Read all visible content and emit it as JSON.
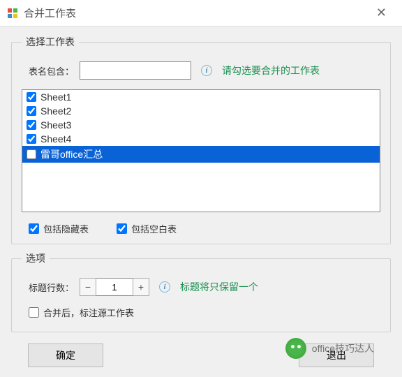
{
  "window": {
    "title": "合并工作表"
  },
  "group_select": {
    "legend": "选择工作表",
    "filter_label": "表名包含：",
    "filter_value": "",
    "hint": "请勾选要合并的工作表",
    "items": [
      {
        "label": "Sheet1",
        "checked": true,
        "selected": false
      },
      {
        "label": "Sheet2",
        "checked": true,
        "selected": false
      },
      {
        "label": "Sheet3",
        "checked": true,
        "selected": false
      },
      {
        "label": "Sheet4",
        "checked": true,
        "selected": false
      },
      {
        "label": "雷哥office汇总",
        "checked": false,
        "selected": true
      }
    ],
    "include_hidden": {
      "label": "包括隐藏表",
      "checked": true
    },
    "include_blank": {
      "label": "包括空白表",
      "checked": true
    }
  },
  "group_options": {
    "legend": "选项",
    "title_rows_label": "标题行数：",
    "title_rows_value": "1",
    "title_rows_hint": "标题将只保留一个",
    "annotate_source": {
      "label": "合并后，标注源工作表",
      "checked": false
    }
  },
  "buttons": {
    "ok": "确定",
    "exit": "退出"
  },
  "watermark": {
    "text": "office技巧达人"
  },
  "icons": {
    "info": "i"
  }
}
